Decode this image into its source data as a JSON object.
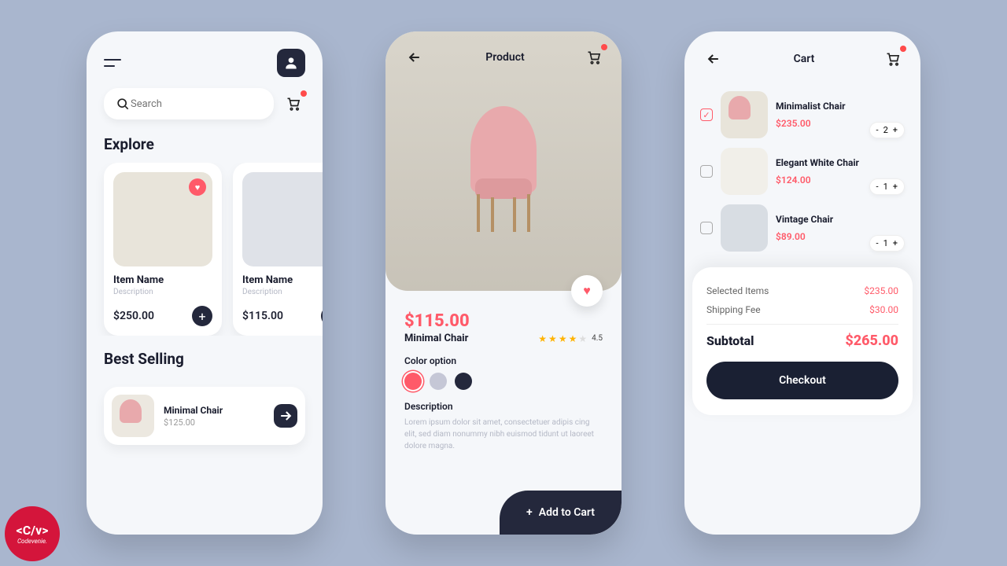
{
  "colors": {
    "accent": "#ff5a69",
    "dark": "#24283c"
  },
  "logo": {
    "code": "<C/v>",
    "name": "Codevenie."
  },
  "screen1": {
    "search_placeholder": "Search",
    "explore_heading": "Explore",
    "cards": [
      {
        "title": "Item Name",
        "subtitle": "Description",
        "price": "$250.00",
        "fav": true
      },
      {
        "title": "Item Name",
        "subtitle": "Description",
        "price": "$115.00",
        "fav": false
      }
    ],
    "best_heading": "Best Selling",
    "best": {
      "name": "Minimal Chair",
      "price": "$125.00"
    }
  },
  "screen2": {
    "title": "Product",
    "price": "$115.00",
    "name": "Minimal Chair",
    "rating": 4.5,
    "color_label": "Color option",
    "colors": [
      "#ff5a69",
      "#c5c7d6",
      "#24283c"
    ],
    "desc_label": "Description",
    "desc_text": "Lorem ipsum dolor sit amet, consectetuer adipis cing elit, sed diam nonummy nibh euismod tidunt ut laoreet dolore magna.",
    "add_to_cart": "Add to Cart"
  },
  "screen3": {
    "title": "Cart",
    "items": [
      {
        "name": "Minimalist Chair",
        "price": "$235.00",
        "qty": 2,
        "checked": true
      },
      {
        "name": "Elegant White Chair",
        "price": "$124.00",
        "qty": 1,
        "checked": false
      },
      {
        "name": "Vintage Chair",
        "price": "$89.00",
        "qty": 1,
        "checked": false
      }
    ],
    "selected_label": "Selected Items",
    "selected_value": "$235.00",
    "shipping_label": "Shipping Fee",
    "shipping_value": "$30.00",
    "subtotal_label": "Subtotal",
    "subtotal_value": "$265.00",
    "checkout": "Checkout"
  }
}
